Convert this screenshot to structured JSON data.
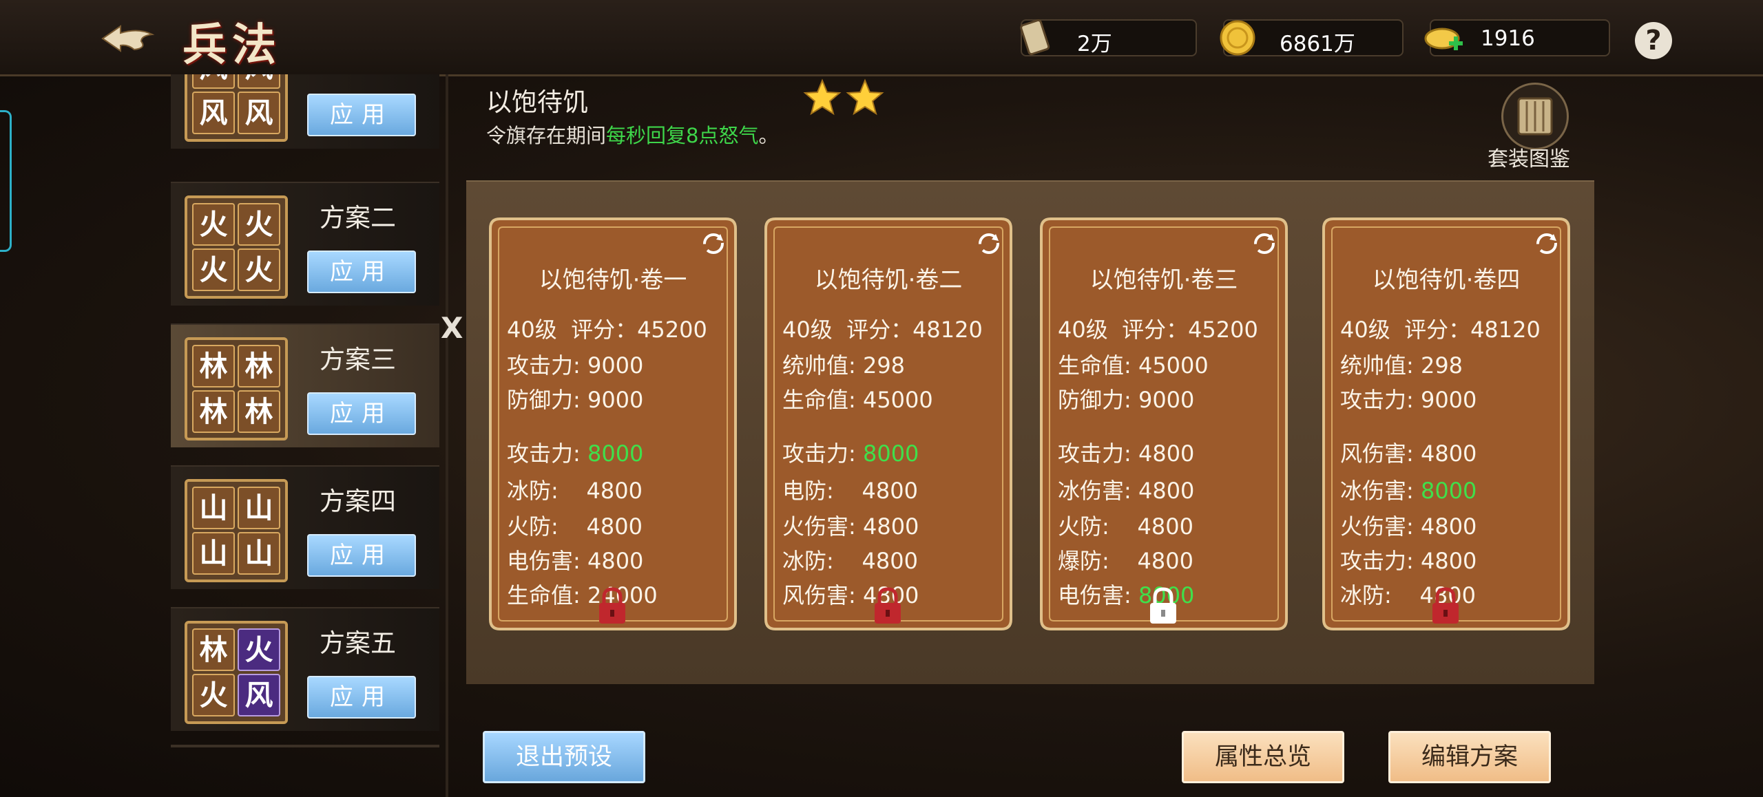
{
  "header": {
    "title": "兵法",
    "resources": [
      {
        "icon": "scroll-icon",
        "value": "2万"
      },
      {
        "icon": "gold-coin-icon",
        "value": "6861万"
      },
      {
        "icon": "ingot-plus-icon",
        "value": "1916"
      }
    ],
    "help": "?"
  },
  "schemes": [
    {
      "name": "",
      "tiles": [
        "风",
        "风",
        "风",
        "风"
      ],
      "apply": "应用"
    },
    {
      "name": "方案二",
      "tiles": [
        "火",
        "火",
        "火",
        "火"
      ],
      "apply": "应用"
    },
    {
      "name": "方案三",
      "tiles": [
        "林",
        "林",
        "林",
        "林"
      ],
      "apply": "应用"
    },
    {
      "name": "方案四",
      "tiles": [
        "山",
        "山",
        "山",
        "山"
      ],
      "apply": "应用"
    },
    {
      "name": "方案五",
      "tiles": [
        "林",
        "火",
        "火",
        "风"
      ],
      "apply": "应用"
    }
  ],
  "close": "X",
  "set": {
    "name": "以饱待饥",
    "stars": 2,
    "desc_prefix": "令旗存在期间",
    "desc_highlight": "每秒回复8点怒气",
    "desc_suffix": "。",
    "gallery_label": "套装图鉴"
  },
  "cards": [
    {
      "title": "以饱待饥·卷一",
      "level_score": "40级  评分：45200",
      "base": [
        "攻击力: 9000",
        "防御力: 9000"
      ],
      "extra": [
        {
          "label": "攻击力: ",
          "value": "8000",
          "green": true
        },
        {
          "label": "冰防:    ",
          "value": "4800",
          "green": false
        },
        {
          "label": "火防:    ",
          "value": "4800",
          "green": false
        },
        {
          "label": "电伤害: ",
          "value": "4800",
          "green": false
        },
        {
          "label": "生命值: ",
          "value": "24000",
          "green": false
        }
      ],
      "lock": "red"
    },
    {
      "title": "以饱待饥·卷二",
      "level_score": "40级  评分：48120",
      "base": [
        "统帅值: 298",
        "生命值: 45000"
      ],
      "extra": [
        {
          "label": "攻击力: ",
          "value": "8000",
          "green": true
        },
        {
          "label": "电防:    ",
          "value": "4800",
          "green": false
        },
        {
          "label": "火伤害: ",
          "value": "4800",
          "green": false
        },
        {
          "label": "冰防:    ",
          "value": "4800",
          "green": false
        },
        {
          "label": "风伤害: ",
          "value": "4800",
          "green": false
        }
      ],
      "lock": "red"
    },
    {
      "title": "以饱待饥·卷三",
      "level_score": "40级  评分：45200",
      "base": [
        "生命值: 45000",
        "防御力: 9000"
      ],
      "extra": [
        {
          "label": "攻击力: ",
          "value": "4800",
          "green": false
        },
        {
          "label": "冰伤害: ",
          "value": "4800",
          "green": false
        },
        {
          "label": "火防:    ",
          "value": "4800",
          "green": false
        },
        {
          "label": "爆防:    ",
          "value": "4800",
          "green": false
        },
        {
          "label": "电伤害: ",
          "value": "8000",
          "green": true
        }
      ],
      "lock": "white"
    },
    {
      "title": "以饱待饥·卷四",
      "level_score": "40级  评分：48120",
      "base": [
        "统帅值: 298",
        "攻击力: 9000"
      ],
      "extra": [
        {
          "label": "风伤害: ",
          "value": "4800",
          "green": false
        },
        {
          "label": "冰伤害: ",
          "value": "8000",
          "green": true
        },
        {
          "label": "火伤害: ",
          "value": "4800",
          "green": false
        },
        {
          "label": "攻击力: ",
          "value": "4800",
          "green": false
        },
        {
          "label": "冰防:    ",
          "value": "4800",
          "green": false
        }
      ],
      "lock": "red"
    }
  ],
  "buttons": {
    "exit": "退出预设",
    "overview": "属性总览",
    "edit": "编辑方案"
  },
  "colors": {
    "highlight_green": "#3fe04b",
    "card_brown": "#a15d2c",
    "button_blue": "#8cc4f0",
    "button_gold": "#f4c995"
  }
}
